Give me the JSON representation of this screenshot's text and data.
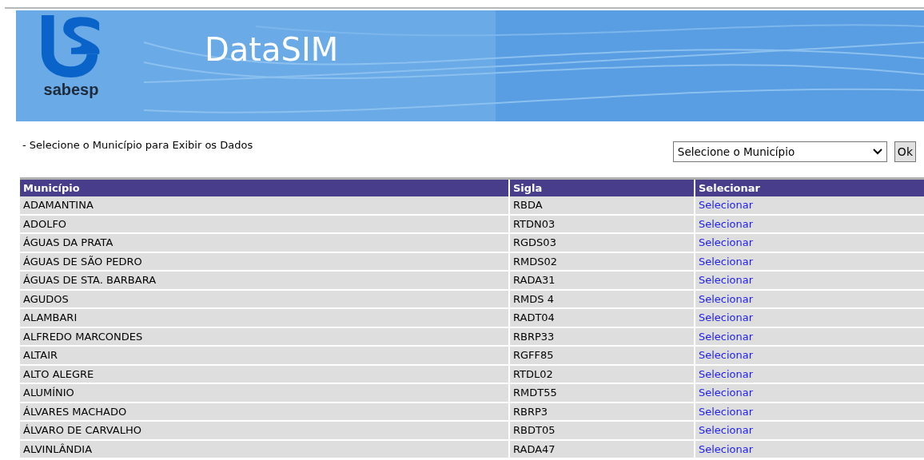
{
  "banner": {
    "logo_text": "sabesp",
    "title": "DataSIM"
  },
  "instruction": "- Selecione o Município para Exibir os Dados",
  "municipio_select": {
    "value": "Selecione o Município"
  },
  "ok_button": "Ok",
  "table": {
    "columns": [
      "Município",
      "Sigla",
      "Selecionar"
    ],
    "rows": [
      {
        "municipio": "ADAMANTINA",
        "sigla": "RBDA",
        "link": "Selecionar"
      },
      {
        "municipio": "ADOLFO",
        "sigla": "RTDN03",
        "link": "Selecionar"
      },
      {
        "municipio": "ÁGUAS DA PRATA",
        "sigla": "RGDS03",
        "link": "Selecionar"
      },
      {
        "municipio": "ÁGUAS DE SÃO PEDRO",
        "sigla": "RMDS02",
        "link": "Selecionar"
      },
      {
        "municipio": "ÁGUAS DE STA. BARBARA",
        "sigla": "RADA31",
        "link": "Selecionar"
      },
      {
        "municipio": "AGUDOS",
        "sigla": "RMDS 4",
        "link": "Selecionar"
      },
      {
        "municipio": "ALAMBARI",
        "sigla": "RADT04",
        "link": "Selecionar"
      },
      {
        "municipio": "ALFREDO MARCONDES",
        "sigla": "RBRP33",
        "link": "Selecionar"
      },
      {
        "municipio": "ALTAIR",
        "sigla": "RGFF85",
        "link": "Selecionar"
      },
      {
        "municipio": "ALTO ALEGRE",
        "sigla": "RTDL02",
        "link": "Selecionar"
      },
      {
        "municipio": "ALUMÍNIO",
        "sigla": "RMDT55",
        "link": "Selecionar"
      },
      {
        "municipio": "ÁLVARES MACHADO",
        "sigla": "RBRP3",
        "link": "Selecionar"
      },
      {
        "municipio": "ÁLVARO DE CARVALHO",
        "sigla": "RBDT05",
        "link": "Selecionar"
      },
      {
        "municipio": "ALVINLÂNDIA",
        "sigla": "RADA47",
        "link": "Selecionar"
      }
    ]
  }
}
